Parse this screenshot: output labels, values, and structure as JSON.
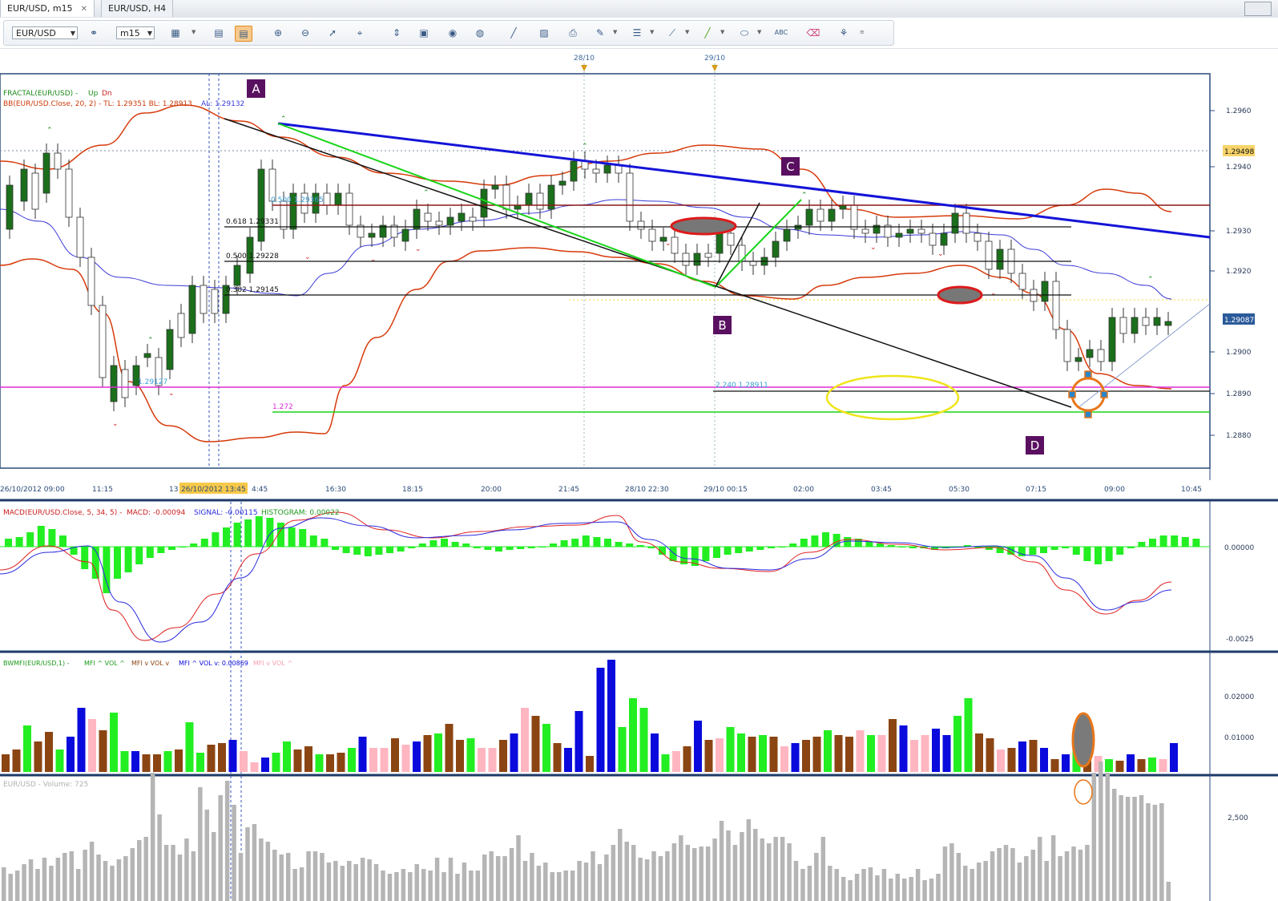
{
  "tabs": [
    {
      "label": "EUR/USD, m15",
      "active": true
    },
    {
      "label": "EUR/USD, H4",
      "active": false
    }
  ],
  "toolbar": {
    "symbol": "EUR/USD",
    "timeframe": "m15",
    "buttons": [
      "link-icon",
      "bar-style-icon",
      "layout-icon",
      "layout-active-icon",
      "zoom-in-icon",
      "zoom-out-icon",
      "cursor-icon",
      "crosshair-icon",
      "fit-icon",
      "template-icon",
      "eye-icon",
      "globe-icon",
      "ruler-icon",
      "image-icon",
      "print-icon",
      "pen-icon",
      "lines-icon",
      "fib-icon",
      "trendline-icon",
      "ellipse-icon",
      "text-icon",
      "eraser-icon",
      "objects-icon"
    ]
  },
  "top_markers": [
    "28/10",
    "29/10"
  ],
  "price_panel": {
    "indicators": {
      "fractal": "FRACTAL(EUR/USD) - ",
      "fractal_up": "Up",
      "fractal_dn": "Dn",
      "bb_main": "BB(EUR/USD.Close, 20, 2) -  TL: 1.29351  BL: 1.28913",
      "bb_al": "AL: 1.29132"
    },
    "price_ticks": [
      "1.2960",
      "1.2940",
      "1.2930",
      "1.2920",
      "1.2900",
      "1.2890",
      "1.2880"
    ],
    "price_badges": [
      "1.29498",
      "1.29087"
    ],
    "time_axis": [
      "26/10/2012 09:00",
      "11:15",
      "13",
      "26/10/2012 13:45",
      "4:45",
      "16:30",
      "18:15",
      "20:00",
      "21:45",
      "28/10 22:30",
      "29/10 00:15",
      "02:00",
      "03:45",
      "05:30",
      "07:15",
      "09:00",
      "10:45"
    ],
    "points": [
      "A",
      "B",
      "C",
      "D"
    ],
    "fib_labels": [
      "0.618 1.29331",
      "0.500 1.29228",
      "0.382 1.29145",
      "0.500 1.29365",
      "1.29127",
      "2.240 1.28911",
      "1.272"
    ]
  },
  "macd_panel": {
    "title": "MACD(EUR/USD.Close, 5, 34, 5) - ",
    "macd": "MACD: -0.00094",
    "signal": "SIGNAL: -0.00115",
    "histogram": "HISTOGRAM: 0.00022",
    "ticks": [
      "0.00000",
      "-0.0025"
    ]
  },
  "mfi_panel": {
    "title": "BWMFI(EUR/USD,1) - ",
    "legend_a": "MFI ^ VOL ^",
    "legend_b": "MFI v VOL v",
    "legend_c": "MFI ^ VOL v: 0.00869",
    "legend_d": "MFI v VOL ^",
    "ticks": [
      "0.02000",
      "0.01000"
    ]
  },
  "volume_panel": {
    "title": "EUR/USD - Volume: 725",
    "ticks": [
      "2,500"
    ]
  },
  "colors": {
    "bull": "#1b6f1b",
    "bear": "#ffffff",
    "bb": "#d63a0a",
    "ma": "#3a3ad8",
    "fib_magenta": "#e02bd8",
    "fib_green": "#19d419",
    "trend_blue": "#1414d8",
    "label_bg": "#5a1060",
    "mfi_green": "#22ee22",
    "mfi_brown": "#8b4513",
    "mfi_blue": "#0a0adc",
    "mfi_pink": "#ffb6c1",
    "vol": "#b5b5b5"
  }
}
